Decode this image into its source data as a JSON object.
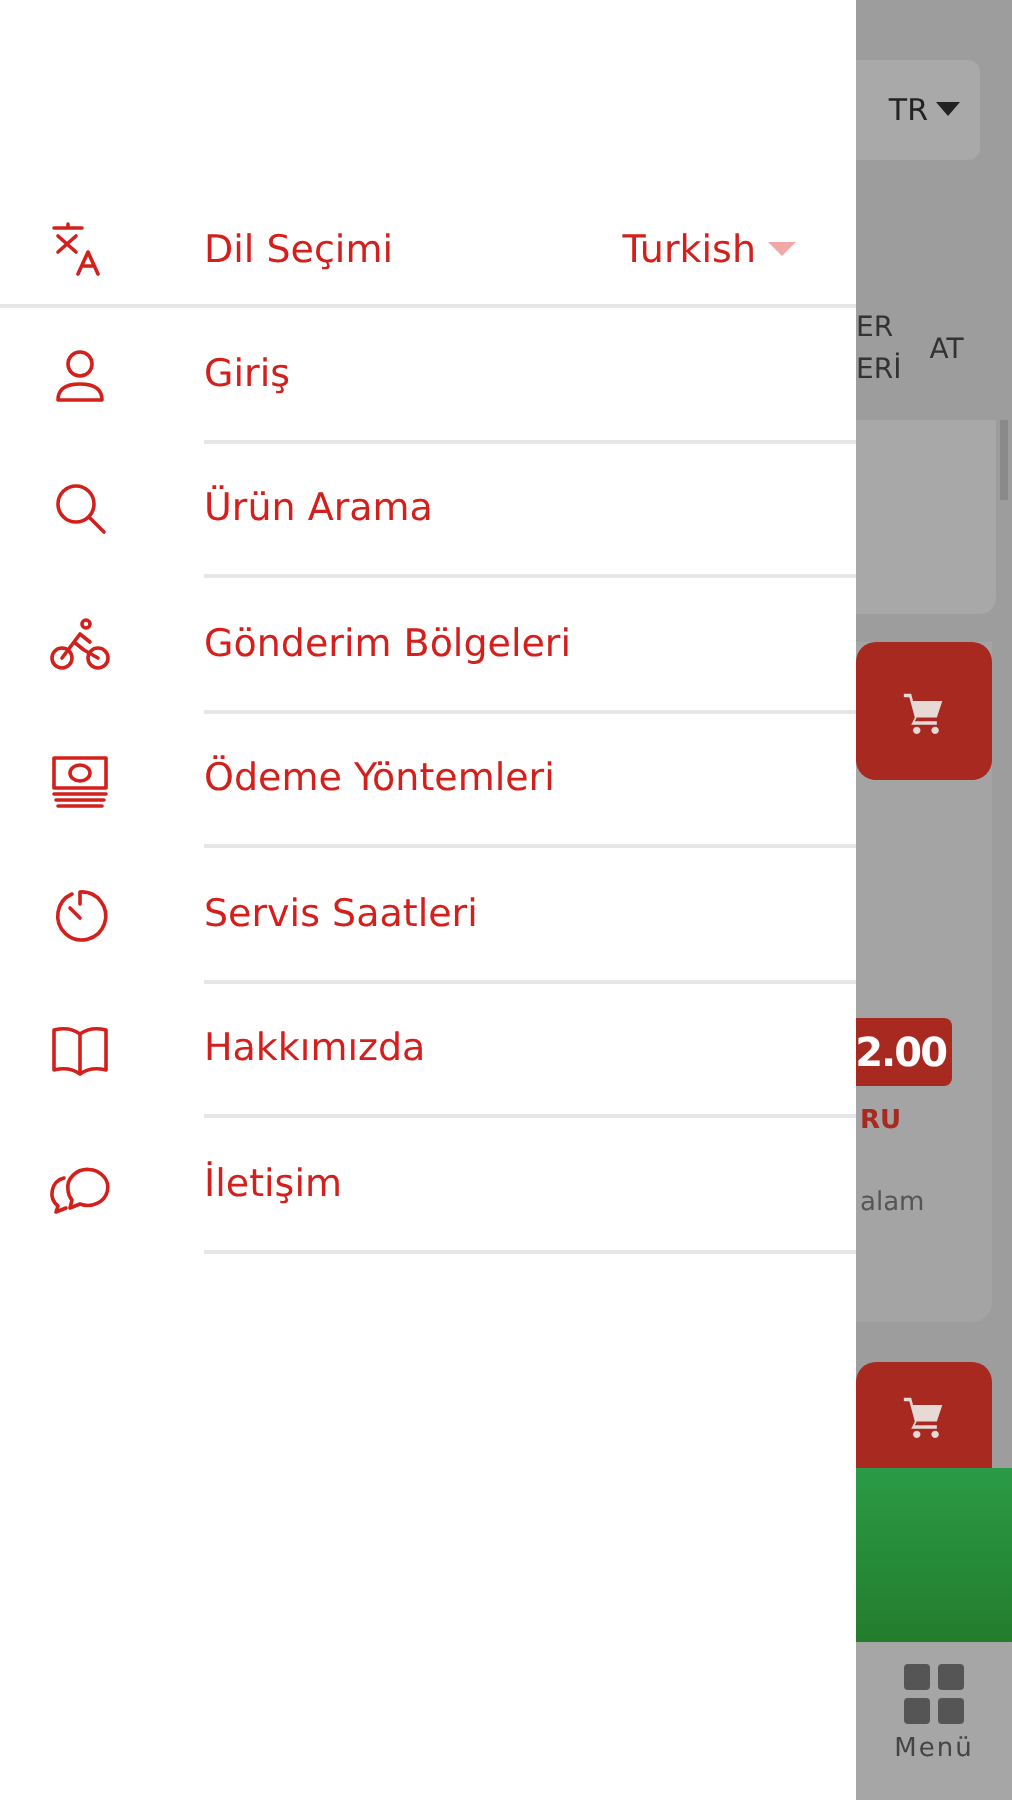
{
  "drawer": {
    "language": {
      "label": "Dil Seçimi",
      "value": "Turkish"
    },
    "items": [
      {
        "label": "Giriş",
        "kind": "user"
      },
      {
        "label": "Ürün Arama",
        "kind": "search"
      },
      {
        "label": "Gönderim Bölgeleri",
        "kind": "bike"
      },
      {
        "label": "Ödeme Yöntemleri",
        "kind": "money"
      },
      {
        "label": "Servis Saatleri",
        "kind": "timer"
      },
      {
        "label": "Hakkımızda",
        "kind": "book"
      },
      {
        "label": "İletişim",
        "kind": "chat"
      }
    ]
  },
  "background_app": {
    "language_button": "TR",
    "tabs": [
      {
        "lines": [
          "ER",
          "ERİ"
        ]
      },
      {
        "lines": [
          "AT"
        ]
      }
    ],
    "product": {
      "price": "2.00",
      "name": "RU",
      "description": "alam"
    },
    "bottom_nav": {
      "label": "Menü"
    }
  }
}
